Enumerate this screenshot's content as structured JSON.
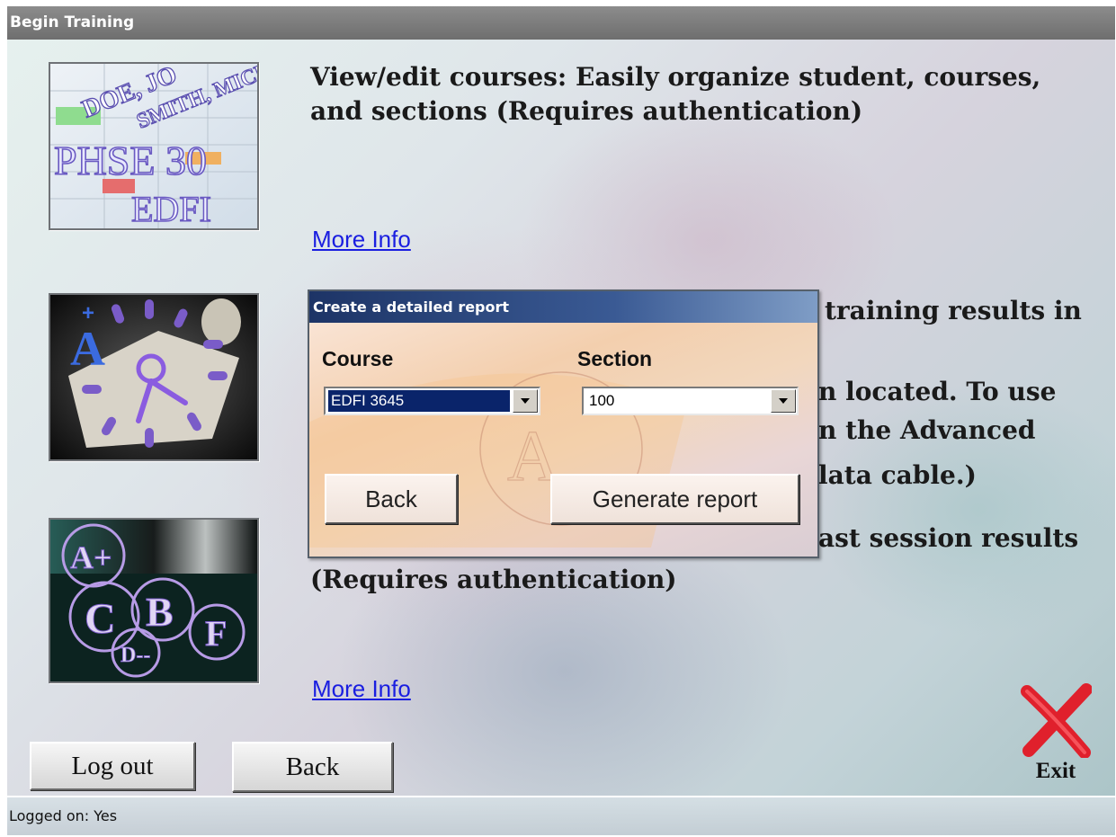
{
  "window": {
    "title": "Begin Training"
  },
  "sections": [
    {
      "description": "View/edit courses: Easily organize student, courses, and sections (Requires authentication)",
      "link": "More Info"
    },
    {
      "visible_fragments": [
        "training results in",
        "n located. To use",
        "n the Advanced",
        "lata cable.)"
      ]
    },
    {
      "fragment": "ast session results",
      "line2": "(Requires authentication)",
      "link": "More Info"
    }
  ],
  "buttons": {
    "logout": "Log out",
    "back": "Back",
    "exit": "Exit"
  },
  "status": {
    "text": "Logged on: Yes"
  },
  "dialog": {
    "title": "Create a detailed report",
    "course_label": "Course",
    "section_label": "Section",
    "course_value": "EDFI 3645",
    "section_value": "100",
    "back_button": "Back",
    "generate_button": "Generate report"
  },
  "thumbnail_1": {
    "lines": [
      "DOE, JO",
      "SMITH, MICH",
      "PHSE 30",
      "EDFI"
    ]
  },
  "thumbnail_3": {
    "grades": [
      "A+",
      "C",
      "B",
      "D--",
      "F"
    ]
  },
  "colors": {
    "link": "#1a1ee0",
    "exit_x": "#e0202c",
    "dialog_title_bg": "#1d3466",
    "combo_selected_bg": "#0a246a"
  }
}
